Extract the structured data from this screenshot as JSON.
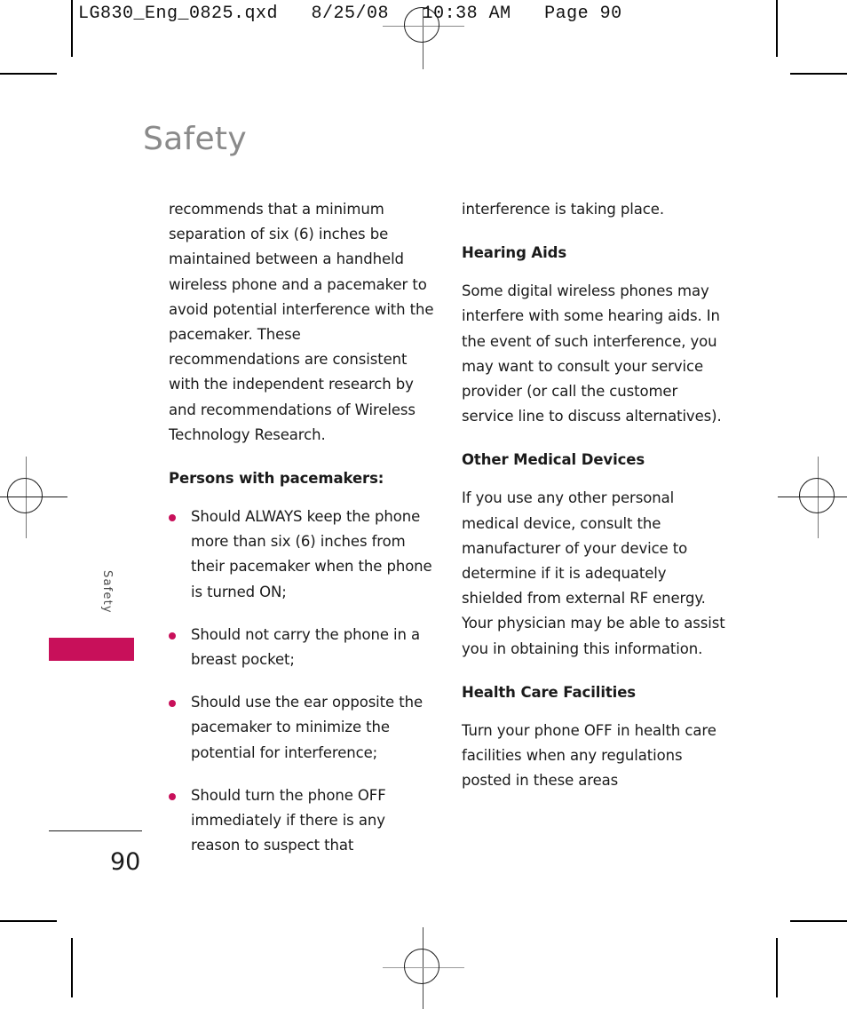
{
  "print_header": "LG830_Eng_0825.qxd   8/25/08   10:38 AM   Page 90",
  "chapter": {
    "title": "Safety",
    "side_tab_label": "Safety",
    "accent_color": "#c8105a",
    "title_color": "#8a8a8a"
  },
  "folio": "90",
  "columns": {
    "left": {
      "paragraph_continued": "recommends that a minimum separation of six (6) inches be maintained between a handheld wireless phone and a pacemaker to avoid potential interference with the pacemaker. These recommendations are consistent with the independent research by and recommendations of Wireless Technology Research.",
      "subhead": "Persons with pacemakers:",
      "bullets": [
        "Should ALWAYS keep the phone more than six (6) inches from their pacemaker when the phone is turned ON;",
        "Should not carry the phone in a breast pocket;",
        "Should use the ear opposite the pacemaker to minimize the potential for interference;",
        "Should turn the phone OFF immediately if there is any reason to suspect that"
      ]
    },
    "right": {
      "paragraph_continued": "interference is taking place.",
      "sections": [
        {
          "heading": "Hearing Aids",
          "body": "Some digital wireless phones may interfere with some hearing aids. In the event of such interference, you may want to consult your service provider (or call the customer service line to discuss alternatives)."
        },
        {
          "heading": "Other Medical Devices",
          "body": "If you use any other personal medical device, consult the manufacturer of your device to determine if it is adequately shielded from external RF energy. Your physician may be able to assist you in obtaining this information."
        },
        {
          "heading": "Health Care Facilities",
          "body": "Turn your phone OFF in health care facilities when any regulations posted in these areas"
        }
      ]
    }
  }
}
